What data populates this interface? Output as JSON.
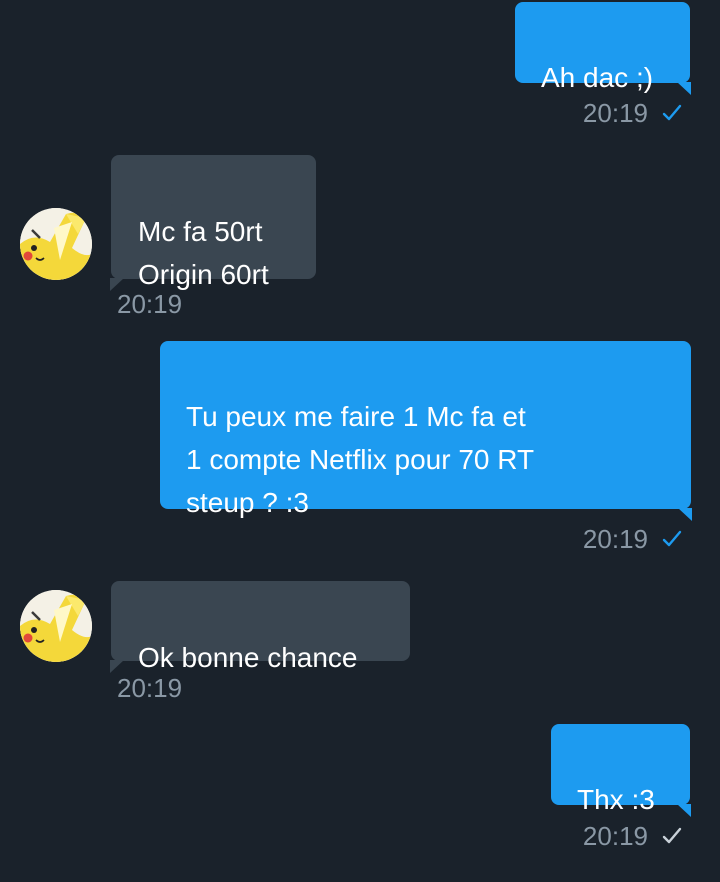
{
  "colors": {
    "background": "#1a222b",
    "outgoing_bubble": "#1d9bf0",
    "incoming_bubble": "#3a4651",
    "timestamp": "#8a98a5",
    "check_read": "#1d9bf0",
    "check_sent": "#c9d1d8"
  },
  "messages": [
    {
      "direction": "outgoing",
      "text": "Ah dac ;)",
      "time": "20:19",
      "status_icon": "checkmark-icon-blue"
    },
    {
      "direction": "incoming",
      "text": "Mc fa 50rt\nOrigin 60rt",
      "time": "20:19",
      "avatar_icon": "pikachu-avatar"
    },
    {
      "direction": "outgoing",
      "text": "Tu peux me faire 1 Mc fa et\n1 compte Netflix pour 70 RT\nsteup ? :3",
      "time": "20:19",
      "status_icon": "checkmark-icon-blue"
    },
    {
      "direction": "incoming",
      "text": "Ok bonne chance",
      "time": "20:19",
      "avatar_icon": "pikachu-avatar"
    },
    {
      "direction": "outgoing",
      "text": "Thx :3",
      "time": "20:19",
      "status_icon": "checkmark-icon-grey"
    }
  ]
}
